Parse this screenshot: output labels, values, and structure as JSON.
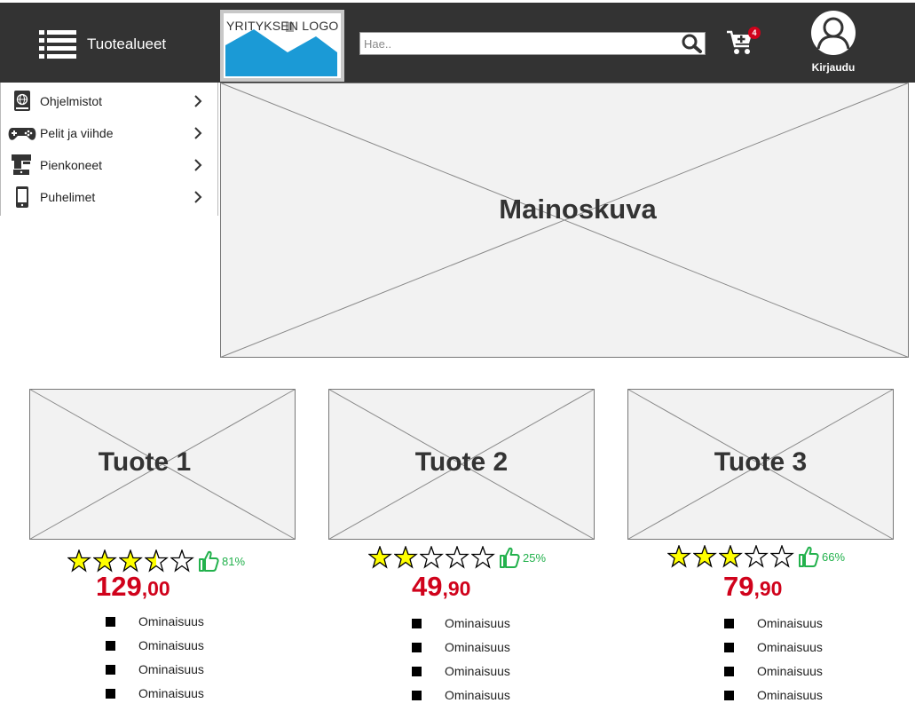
{
  "header": {
    "menu_label": "Tuotealueet",
    "logo_text": "YRITYKSEN LOGO",
    "search_placeholder": "Hae..",
    "cart_count": "4",
    "login_label": "Kirjaudu",
    "bg_color": "#333333"
  },
  "sidebar": {
    "items": [
      {
        "label": "Ohjelmistot",
        "icon": "software-book-icon"
      },
      {
        "label": "Pelit ja viihde",
        "icon": "gamepad-icon"
      },
      {
        "label": "Pienkoneet",
        "icon": "appliance-icon"
      },
      {
        "label": "Puhelimet",
        "icon": "mobile-phone-icon"
      }
    ]
  },
  "banner": {
    "title": "Mainoskuva"
  },
  "products": [
    {
      "title": "Tuote 1",
      "rating": 3.5,
      "like_percent": "81%",
      "price_int": "129",
      "price_dec": ",00",
      "features": [
        "Ominaisuus",
        "Ominaisuus",
        "Ominaisuus",
        "Ominaisuus"
      ]
    },
    {
      "title": "Tuote 2",
      "rating": 2,
      "like_percent": "25%",
      "price_int": "49",
      "price_dec": ",90",
      "features": [
        "Ominaisuus",
        "Ominaisuus",
        "Ominaisuus",
        "Ominaisuus"
      ]
    },
    {
      "title": "Tuote 3",
      "rating": 3,
      "like_percent": "66%",
      "price_int": "79",
      "price_dec": ",90",
      "features": [
        "Ominaisuus",
        "Ominaisuus",
        "Ominaisuus",
        "Ominaisuus"
      ]
    }
  ],
  "colors": {
    "price": "#d0021b",
    "like": "#22b14c",
    "star": "#ffff00",
    "badge": "#d0021b"
  }
}
